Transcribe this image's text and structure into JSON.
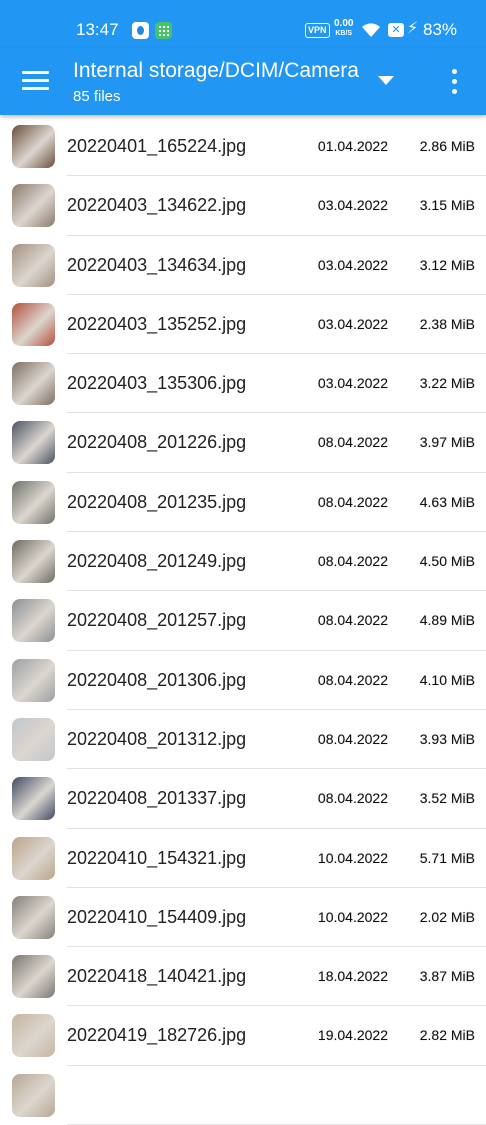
{
  "status_bar": {
    "time": "13:47",
    "vpn": "VPN",
    "speed_value": "0.00",
    "speed_unit": "KB/S",
    "battery": "83%",
    "icons": [
      "app-icon",
      "grid-app-icon",
      "vpn-icon",
      "wifi-icon",
      "close-box-icon",
      "charging-icon"
    ]
  },
  "app_bar": {
    "title": "Internal storage/DCIM/Camera",
    "subtitle": "85 files",
    "menu_icon": "hamburger-menu-icon",
    "dropdown_icon": "triangle-down-icon",
    "more_icon": "more-vert-icon",
    "color": "#2196f3"
  },
  "files": [
    {
      "name": "20220401_165224.jpg",
      "date": "01.04.2022",
      "size": "2.86 MiB",
      "thumb": "#6b4e3d"
    },
    {
      "name": "20220403_134622.jpg",
      "date": "03.04.2022",
      "size": "3.15 MiB",
      "thumb": "#8c7a6c"
    },
    {
      "name": "20220403_134634.jpg",
      "date": "03.04.2022",
      "size": "3.12 MiB",
      "thumb": "#a39080"
    },
    {
      "name": "20220403_135252.jpg",
      "date": "03.04.2022",
      "size": "2.38 MiB",
      "thumb": "#b3503c"
    },
    {
      "name": "20220403_135306.jpg",
      "date": "03.04.2022",
      "size": "3.22 MiB",
      "thumb": "#7d6e62"
    },
    {
      "name": "20220408_201226.jpg",
      "date": "08.04.2022",
      "size": "3.97 MiB",
      "thumb": "#4a5363"
    },
    {
      "name": "20220408_201235.jpg",
      "date": "08.04.2022",
      "size": "4.63 MiB",
      "thumb": "#6c7269"
    },
    {
      "name": "20220408_201249.jpg",
      "date": "08.04.2022",
      "size": "4.50 MiB",
      "thumb": "#6d6a62"
    },
    {
      "name": "20220408_201257.jpg",
      "date": "08.04.2022",
      "size": "4.89 MiB",
      "thumb": "#8a9094"
    },
    {
      "name": "20220408_201306.jpg",
      "date": "08.04.2022",
      "size": "4.10 MiB",
      "thumb": "#9aa0a2"
    },
    {
      "name": "20220408_201312.jpg",
      "date": "08.04.2022",
      "size": "3.93 MiB",
      "thumb": "#c0c6cc"
    },
    {
      "name": "20220408_201337.jpg",
      "date": "08.04.2022",
      "size": "3.52 MiB",
      "thumb": "#3e4a63"
    },
    {
      "name": "20220410_154321.jpg",
      "date": "10.04.2022",
      "size": "5.71 MiB",
      "thumb": "#b9a489"
    },
    {
      "name": "20220410_154409.jpg",
      "date": "10.04.2022",
      "size": "2.02 MiB",
      "thumb": "#85807a"
    },
    {
      "name": "20220418_140421.jpg",
      "date": "18.04.2022",
      "size": "3.87 MiB",
      "thumb": "#7a7670"
    },
    {
      "name": "20220419_182726.jpg",
      "date": "19.04.2022",
      "size": "2.82 MiB",
      "thumb": "#c5b5a0"
    },
    {
      "name": "",
      "date": "",
      "size": "",
      "thumb": "#b8a794"
    }
  ]
}
